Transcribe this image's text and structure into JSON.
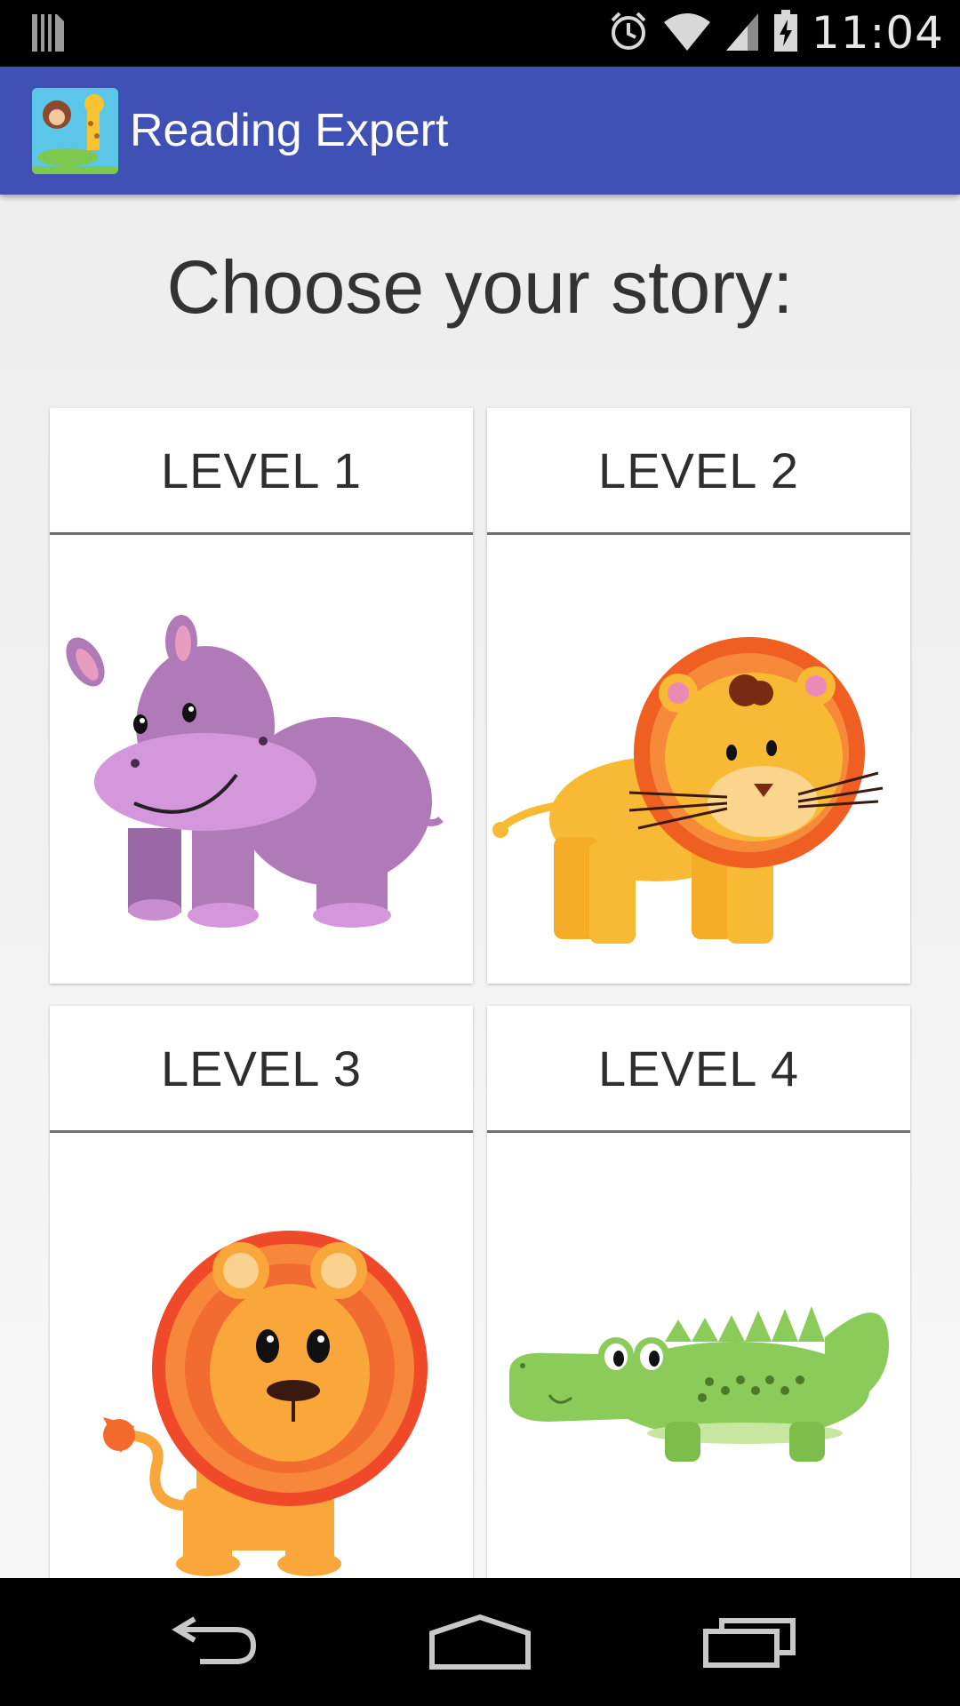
{
  "status_bar": {
    "time": "11:04",
    "icons": [
      "sim-card-icon",
      "alarm-icon",
      "wifi-icon",
      "signal-icon",
      "battery-charging-icon"
    ]
  },
  "app_bar": {
    "title": "Reading Expert",
    "icon": "app-logo-icon",
    "color": "#3f51b5"
  },
  "main": {
    "heading": "Choose your story:",
    "levels": [
      {
        "label": "LEVEL 1",
        "image": "hippo-illustration"
      },
      {
        "label": "LEVEL 2",
        "image": "lion-cub-illustration"
      },
      {
        "label": "LEVEL 3",
        "image": "lion-illustration"
      },
      {
        "label": "LEVEL 4",
        "image": "crocodile-illustration"
      }
    ]
  },
  "nav_bar": {
    "buttons": [
      "back-icon",
      "home-icon",
      "recents-icon"
    ]
  }
}
